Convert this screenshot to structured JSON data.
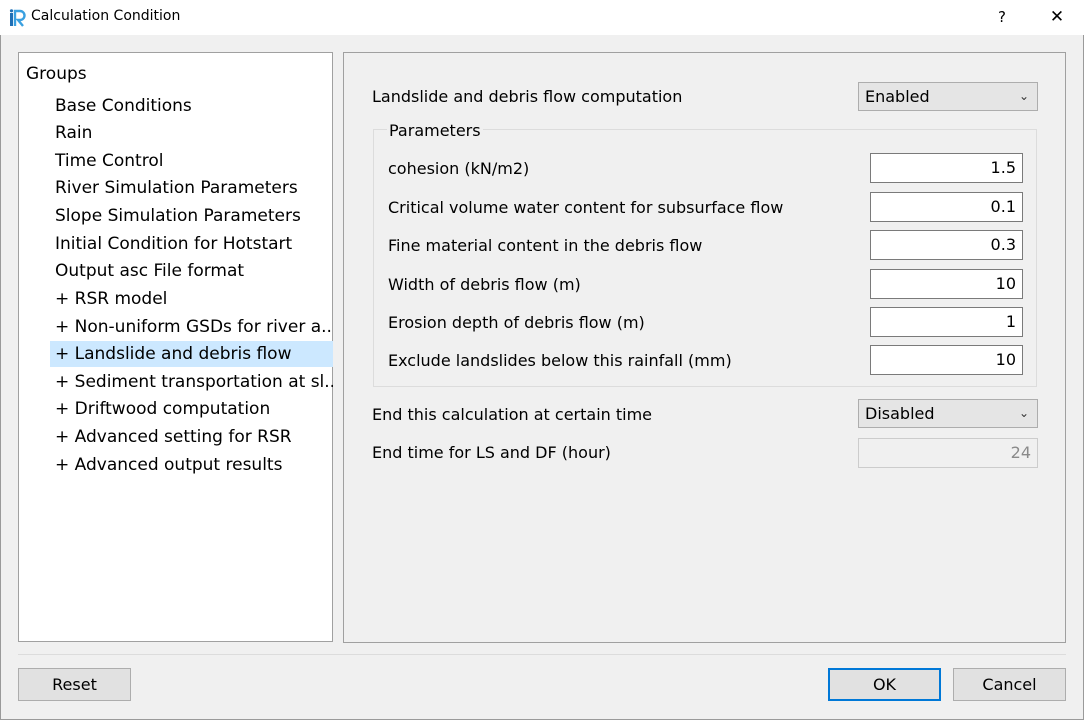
{
  "window": {
    "title": "Calculation Condition",
    "help_label": "?",
    "close_label": "✕",
    "accent_color": "#0078d7"
  },
  "tree": {
    "header": "Groups",
    "items": [
      {
        "label": "Base Conditions"
      },
      {
        "label": "Rain"
      },
      {
        "label": "Time Control"
      },
      {
        "label": "River Simulation Parameters"
      },
      {
        "label": "Slope Simulation Parameters"
      },
      {
        "label": "Initial Condition for Hotstart"
      },
      {
        "label": "Output asc File format"
      },
      {
        "label": "+ RSR model"
      },
      {
        "label": "+ Non-uniform GSDs for river a..."
      },
      {
        "label": "+ Landslide and debris flow"
      },
      {
        "label": "+ Sediment transportation at sl..."
      },
      {
        "label": "+ Driftwood computation"
      },
      {
        "label": "+ Advanced setting for RSR"
      },
      {
        "label": "+ Advanced output results"
      }
    ],
    "selected_index": 9,
    "selected_color": "#cce8ff"
  },
  "settings": {
    "computation_label": "Landslide and debris flow computation",
    "computation_value": "Enabled",
    "parameters_title": "Parameters",
    "params": [
      {
        "label": "cohesion (kN/m2)",
        "value": "1.5"
      },
      {
        "label": "Critical volume water content for subsurface flow",
        "value": "0.1"
      },
      {
        "label": "Fine material content in the debris flow",
        "value": "0.3"
      },
      {
        "label": "Width of debris flow (m)",
        "value": "10"
      },
      {
        "label": "Erosion depth of debris flow (m)",
        "value": "1"
      },
      {
        "label": "Exclude landslides below this rainfall (mm)",
        "value": "10"
      }
    ],
    "end_calc_label": "End this calculation at certain time",
    "end_calc_value": "Disabled",
    "end_time_label": "End time for LS and DF (hour)",
    "end_time_value": "24"
  },
  "buttons": {
    "reset": "Reset",
    "ok": "OK",
    "cancel": "Cancel"
  }
}
